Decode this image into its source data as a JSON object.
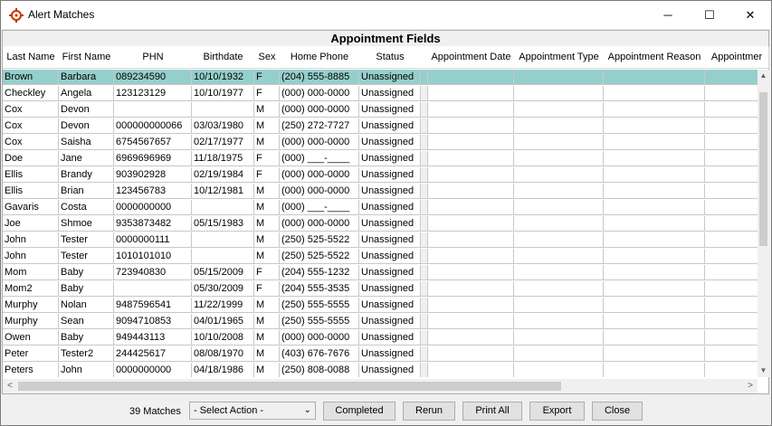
{
  "window": {
    "title": "Alert Matches",
    "min_glyph": "─",
    "max_glyph": "☐",
    "close_glyph": "✕"
  },
  "grid": {
    "group_title": "Appointment Fields",
    "columns": [
      "Last Name",
      "First Name",
      "PHN",
      "Birthdate",
      "Sex",
      "Home Phone",
      "Status",
      "",
      "Appointment Date",
      "Appointment Type",
      "Appointment Reason",
      "Appointmer"
    ],
    "rows": [
      [
        "Brown",
        "Barbara",
        "089234590",
        "10/10/1932",
        "F",
        "(204) 555-8885",
        "Unassigned"
      ],
      [
        "Checkley",
        "Angela",
        "123123129",
        "10/10/1977",
        "F",
        "(000) 000-0000",
        "Unassigned"
      ],
      [
        "Cox",
        "Devon",
        "",
        "",
        "M",
        "(000) 000-0000",
        "Unassigned"
      ],
      [
        "Cox",
        "Devon",
        "000000000066",
        "03/03/1980",
        "M",
        "(250) 272-7727",
        "Unassigned"
      ],
      [
        "Cox",
        "Saisha",
        "6754567657",
        "02/17/1977",
        "M",
        "(000) 000-0000",
        "Unassigned"
      ],
      [
        "Doe",
        "Jane",
        "6969696969",
        "11/18/1975",
        "F",
        "(000) ___-____",
        "Unassigned"
      ],
      [
        "Ellis",
        "Brandy",
        "903902928",
        "02/19/1984",
        "F",
        "(000) 000-0000",
        "Unassigned"
      ],
      [
        "Ellis",
        "Brian",
        "123456783",
        "10/12/1981",
        "M",
        "(000) 000-0000",
        "Unassigned"
      ],
      [
        "Gavaris",
        "Costa",
        "0000000000",
        "",
        "M",
        "(000) ___-____",
        "Unassigned"
      ],
      [
        "Joe",
        "Shmoe",
        "9353873482",
        "05/15/1983",
        "M",
        "(000) 000-0000",
        "Unassigned"
      ],
      [
        "John",
        "Tester",
        "0000000111",
        "",
        "M",
        "(250) 525-5522",
        "Unassigned"
      ],
      [
        "John",
        "Tester",
        "1010101010",
        "",
        "M",
        "(250) 525-5522",
        "Unassigned"
      ],
      [
        "Mom",
        "Baby",
        "723940830",
        "05/15/2009",
        "F",
        "(204) 555-1232",
        "Unassigned"
      ],
      [
        "Mom2",
        "Baby",
        "",
        "05/30/2009",
        "F",
        "(204) 555-3535",
        "Unassigned"
      ],
      [
        "Murphy",
        "Nolan",
        "9487596541",
        "11/22/1999",
        "M",
        "(250) 555-5555",
        "Unassigned"
      ],
      [
        "Murphy",
        "Sean",
        "9094710853",
        "04/01/1965",
        "M",
        "(250) 555-5555",
        "Unassigned"
      ],
      [
        "Owen",
        "Baby",
        "949443113",
        "10/10/2008",
        "M",
        "(000) 000-0000",
        "Unassigned"
      ],
      [
        "Peter",
        "Tester2",
        "244425617",
        "08/08/1970",
        "M",
        "(403) 676-7676",
        "Unassigned"
      ],
      [
        "Peters",
        "John",
        "0000000000",
        "04/18/1986",
        "M",
        "(250) 808-0088",
        "Unassigned"
      ]
    ],
    "selected_row": 0
  },
  "footer": {
    "matches_label": "39 Matches",
    "action_select": "- Select Action -",
    "completed_label": "Completed",
    "rerun_label": "Rerun",
    "print_all_label": "Print All",
    "export_label": "Export",
    "close_label": "Close"
  },
  "colors": {
    "selected_row": "#95cfcc",
    "app_icon": "#cc3300"
  }
}
